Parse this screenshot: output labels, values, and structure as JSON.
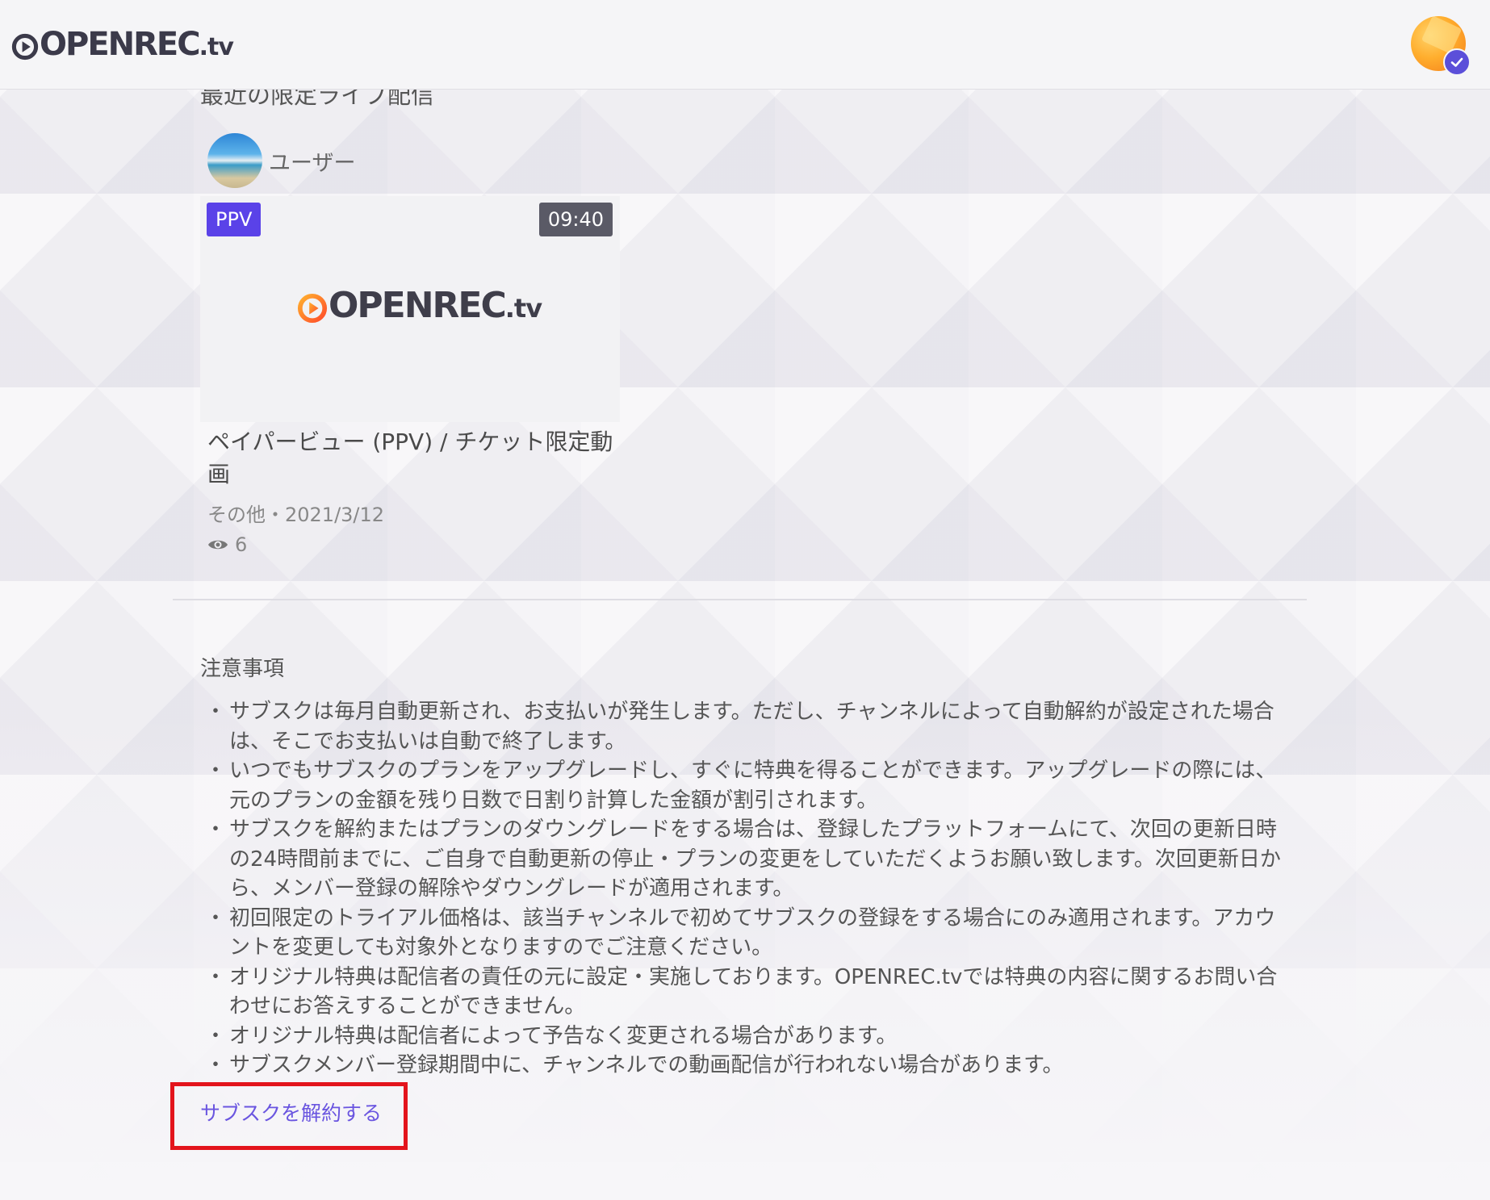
{
  "header": {
    "logo_main": "OPENREC",
    "logo_tv": ".tv"
  },
  "section": {
    "title": "最近の限定ライブ配信"
  },
  "video": {
    "channel_name": "ユーザー",
    "badge": "PPV",
    "duration": "09:40",
    "thumb_logo_main": "OPENREC",
    "thumb_logo_tv": ".tv",
    "title": "ペイパービュー (PPV) / チケット限定動画",
    "meta": "その他・2021/3/12",
    "views": "6"
  },
  "notes": {
    "title": "注意事項",
    "items": [
      "サブスクは毎月自動更新され、お支払いが発生します。ただし、チャンネルによって自動解約が設定された場合は、そこでお支払いは自動で終了します。",
      "いつでもサブスクのプランをアップグレードし、すぐに特典を得ることができます。アップグレードの際には、元のプランの金額を残り日数で日割り計算した金額が割引されます。",
      "サブスクを解約またはプランのダウングレードをする場合は、登録したプラットフォームにて、次回の更新日時の24時間前までに、ご自身で自動更新の停止・プランの変更をしていただくようお願い致します。次回更新日から、メンバー登録の解除やダウングレードが適用されます。",
      "初回限定のトライアル価格は、該当チャンネルで初めてサブスクの登録をする場合にのみ適用されます。アカウントを変更しても対象外となりますのでご注意ください。",
      "オリジナル特典は配信者の責任の元に設定・実施しております。OPENREC.tvでは特典の内容に関するお問い合わせにお答えすることができません。",
      "オリジナル特典は配信者によって予告なく変更される場合があります。",
      "サブスクメンバー登録期間中に、チャンネルでの動画配信が行われない場合があります。"
    ]
  },
  "unsubscribe": {
    "label": "サブスクを解約する"
  },
  "colors": {
    "accent": "#5a42e8",
    "link": "#6a55e0",
    "highlight": "#e3141c",
    "logo_orange": "#ff7a1a"
  },
  "icons": {
    "logo": "openrec-play-logo-icon",
    "views": "eye-icon",
    "verified": "check-badge-icon"
  }
}
